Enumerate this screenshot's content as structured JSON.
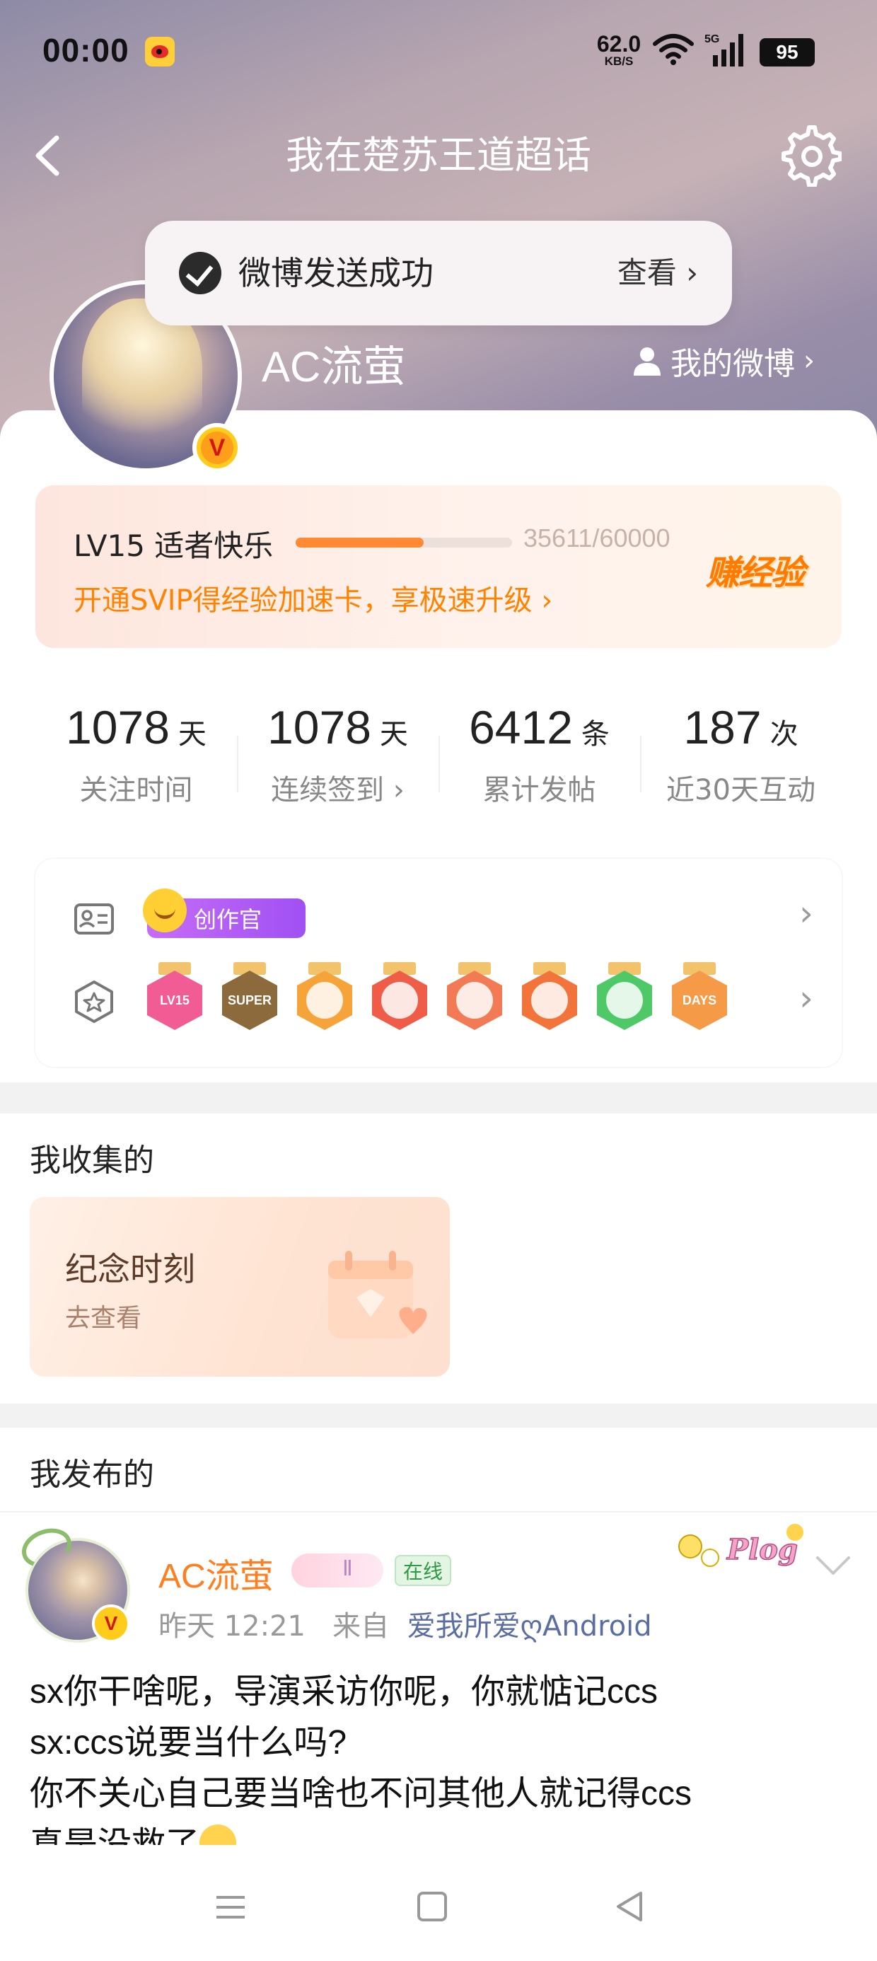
{
  "status_bar": {
    "time": "00:00",
    "net_speed_value": "62.0",
    "net_speed_unit": "KB/S",
    "network_type": "5G",
    "battery": "95",
    "icons": [
      "weibo-app-icon",
      "wifi-icon",
      "signal-icon",
      "battery-icon"
    ]
  },
  "header": {
    "title": "我在楚苏王道超话",
    "back_icon": "chevron-left-icon",
    "settings_icon": "gear-icon"
  },
  "toast": {
    "message": "微博发送成功",
    "action": "查看 ›"
  },
  "profile": {
    "username": "AC流萤",
    "my_weibo": "我的微博",
    "verify_badge": "V"
  },
  "level": {
    "label": "LV15 适者快乐",
    "exp_text": "35611/60000",
    "progress_fraction": 0.593,
    "svip_link": "开通SVIP得经验加速卡，享极速升级 ›",
    "earn_button": "赚经验",
    "accent_color": "#ff8200"
  },
  "stats": [
    {
      "value": "1078",
      "unit": "天",
      "label": "关注时间"
    },
    {
      "value": "1078",
      "unit": "天",
      "label": "连续签到 ›"
    },
    {
      "value": "6412",
      "unit": "条",
      "label": "累计发帖"
    },
    {
      "value": "187",
      "unit": "次",
      "label": "近30天互动"
    }
  ],
  "badges": {
    "creator_tag": "创作官",
    "medals": [
      {
        "name": "lv15-medal",
        "text": "LV15",
        "color": "#f25c94"
      },
      {
        "name": "super-medal",
        "text": "SUPER",
        "color": "#8c6a3b"
      },
      {
        "name": "crown-medal",
        "text": "",
        "color": "#f6a43a"
      },
      {
        "name": "cat-medal-red",
        "text": "",
        "color": "#ef5c48"
      },
      {
        "name": "cat-medal-pink",
        "text": "",
        "color": "#f27a55"
      },
      {
        "name": "cat-medal-orange",
        "text": "",
        "color": "#f3743b"
      },
      {
        "name": "hand-medal",
        "text": "",
        "color": "#4fc968"
      },
      {
        "name": "100-days-medal",
        "text": "DAYS",
        "color": "#f59a47"
      }
    ]
  },
  "collected": {
    "title": "我收集的",
    "card_title": "纪念时刻",
    "card_sub": "去查看"
  },
  "published": {
    "title": "我发布的"
  },
  "post": {
    "author": "AC流萤",
    "online": "在线",
    "time": "昨天 12:21",
    "from_label": "来自",
    "source": "爱我所爱ღAndroid",
    "sticker_text": "Plog",
    "lines": [
      "sx你干啥呢，导演采访你呢，你就惦记ccs",
      "sx:ccs说要当什么吗?",
      "你不关心自己要当啥也不问其他人就记得ccs",
      "真是没救了"
    ]
  },
  "system_nav": [
    "menu-icon",
    "home-icon",
    "back-triangle-icon"
  ]
}
